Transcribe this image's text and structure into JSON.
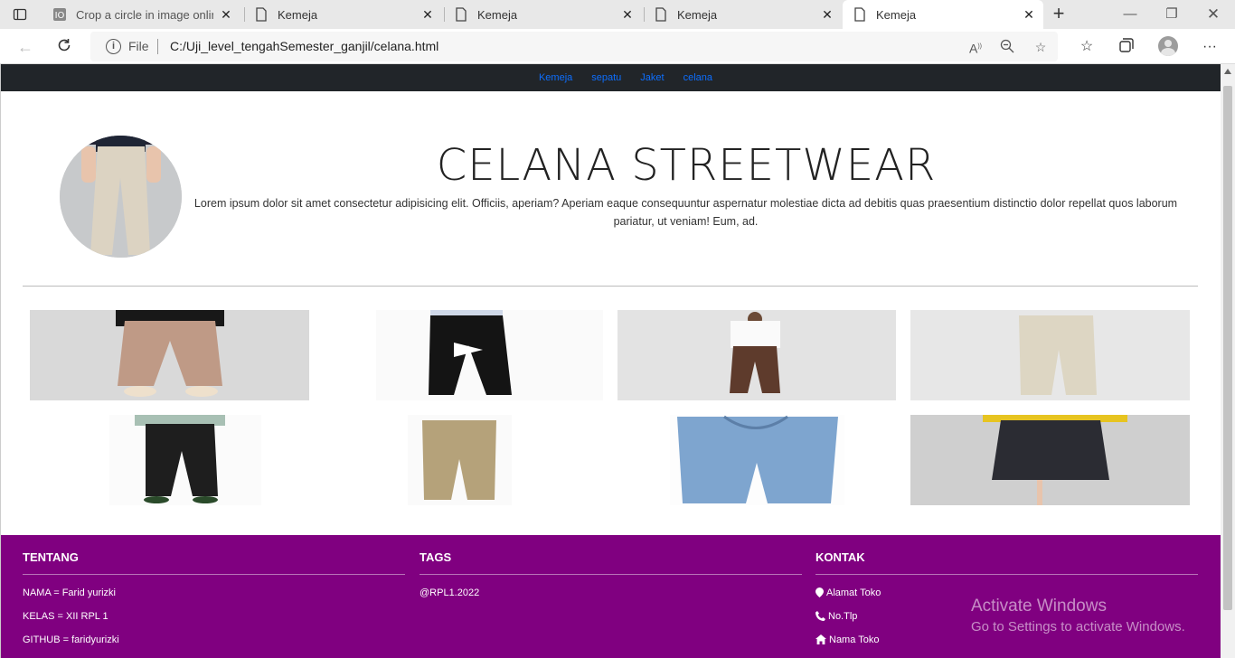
{
  "browser": {
    "tabs": [
      {
        "title": "Crop a circle in image online",
        "active": false,
        "icon": "iloveimg-icon"
      },
      {
        "title": "Kemeja",
        "active": false,
        "icon": "page-icon"
      },
      {
        "title": "Kemeja",
        "active": false,
        "icon": "page-icon"
      },
      {
        "title": "Kemeja",
        "active": false,
        "icon": "page-icon"
      },
      {
        "title": "Kemeja",
        "active": true,
        "icon": "page-icon"
      }
    ],
    "address": {
      "scheme": "File",
      "url": "C:/Uji_level_tengahSemester_ganjil/celana.html"
    }
  },
  "page": {
    "nav": [
      "Kemeja",
      "sepatu",
      "Jaket",
      "celana"
    ],
    "hero": {
      "title": "CELANA STREETWEAR",
      "text": "Lorem ipsum dolor sit amet consectetur adipisicing elit. Officiis, aperiam? Aperiam eaque consequuntur aspernatur molestiae dicta ad debitis quas praesentium distinctio dolor repellat quos laborum pariatur, ut veniam! Eum, ad."
    },
    "footer": {
      "tentang": {
        "heading": "TENTANG",
        "items": [
          "NAMA = Farid yurizki",
          "KELAS = XII RPL 1",
          "GITHUB = faridyurizki"
        ]
      },
      "tags": {
        "heading": "TAGS",
        "items": [
          "@RPL1.2022"
        ]
      },
      "kontak": {
        "heading": "KONTAK",
        "items": [
          "Alamat Toko",
          "No.Tlp",
          "Nama Toko"
        ]
      }
    },
    "watermark": {
      "line1": "Activate Windows",
      "line2": "Go to Settings to activate Windows."
    }
  },
  "colors": {
    "navbar": "#212529",
    "nav_link": "#0d6efd",
    "footer": "#800080"
  }
}
